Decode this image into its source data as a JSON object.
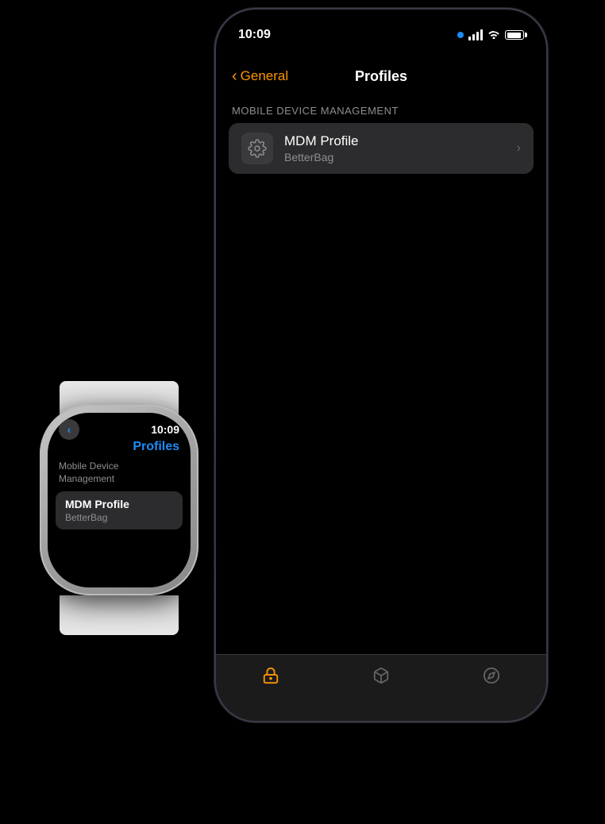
{
  "iphone": {
    "time": "10:09",
    "nav": {
      "back_label": "General",
      "title": "Profiles"
    },
    "section": {
      "label": "MOBILE DEVICE MANAGEMENT"
    },
    "profile_item": {
      "title": "MDM Profile",
      "subtitle": "BetterBag"
    },
    "tab_bar": {
      "icons": [
        "🔒",
        "📦",
        "🧭"
      ]
    }
  },
  "watch": {
    "time": "10:09",
    "title": "Profiles",
    "back_label": "<",
    "section_label": "Mobile Device\nManagement",
    "profile_item": {
      "title": "MDM Profile",
      "subtitle": "BetterBag"
    }
  }
}
